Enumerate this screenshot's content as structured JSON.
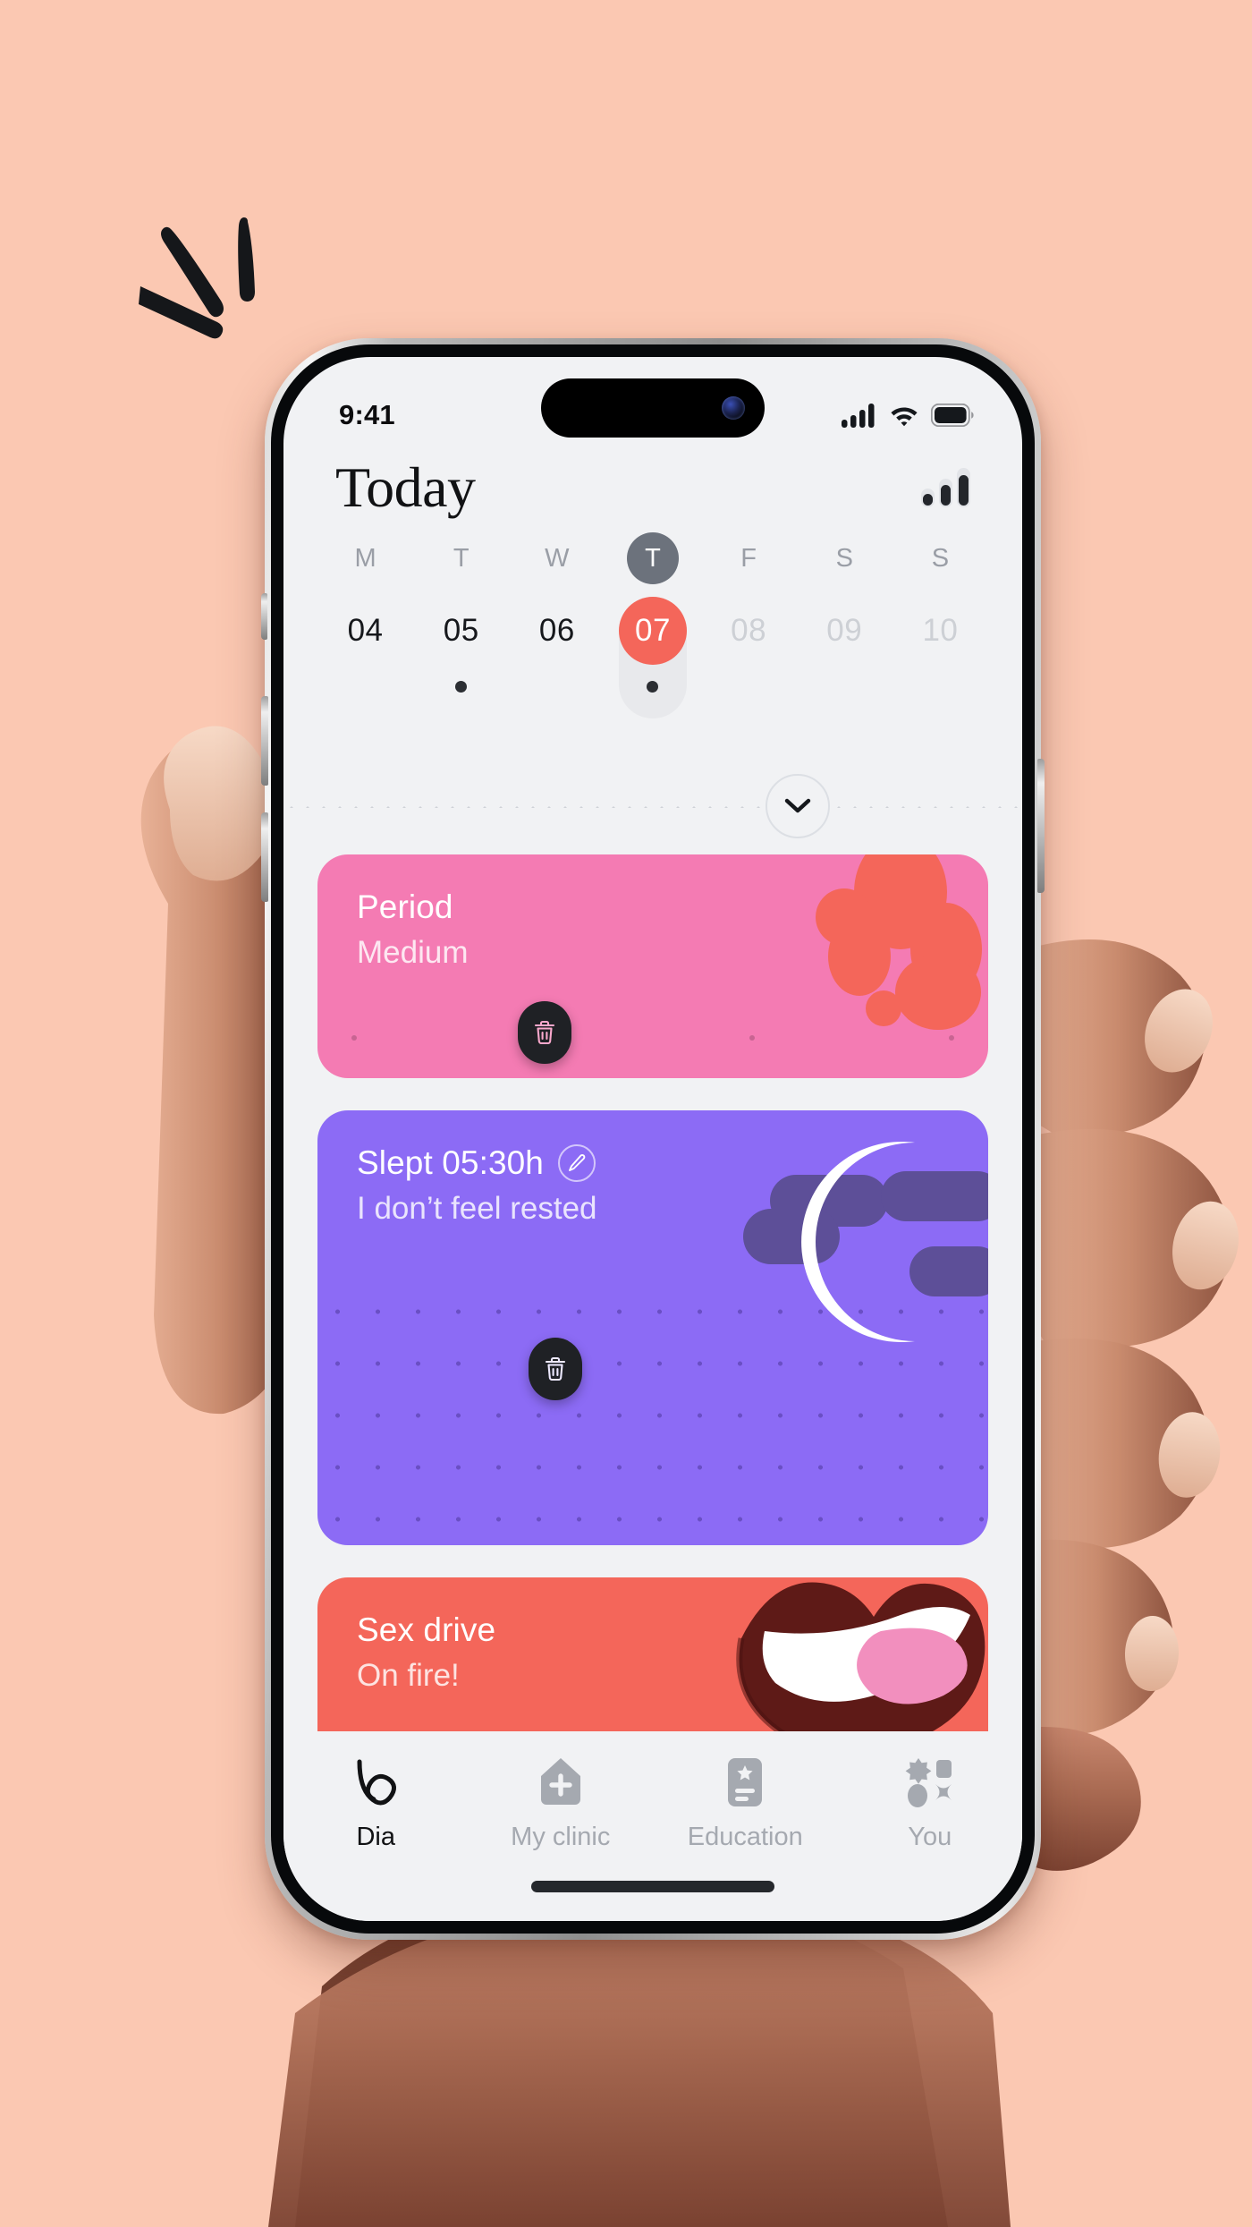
{
  "background_color": "#FBC8B2",
  "status_bar": {
    "time": "9:41",
    "icons": [
      "cellular-signal-icon",
      "wifi-icon",
      "battery-icon"
    ]
  },
  "header": {
    "title": "Today",
    "right_icon": "insights-bars-icon"
  },
  "calendar": {
    "expand_icon": "chevron-down-icon",
    "days": [
      {
        "dow": "M",
        "date": "04",
        "today": false,
        "selected": false,
        "dot": false,
        "past": true
      },
      {
        "dow": "T",
        "date": "05",
        "today": false,
        "selected": false,
        "dot": true,
        "past": true
      },
      {
        "dow": "W",
        "date": "06",
        "today": false,
        "selected": false,
        "dot": false,
        "past": true
      },
      {
        "dow": "T",
        "date": "07",
        "today": true,
        "selected": true,
        "dot": true,
        "past": false
      },
      {
        "dow": "F",
        "date": "08",
        "today": false,
        "selected": false,
        "dot": false,
        "past": false
      },
      {
        "dow": "S",
        "date": "09",
        "today": false,
        "selected": false,
        "dot": false,
        "past": false
      },
      {
        "dow": "S",
        "date": "10",
        "today": false,
        "selected": false,
        "dot": false,
        "past": false
      }
    ],
    "selected_color": "#F4665A",
    "today_dow_color": "#6C727C"
  },
  "cards": [
    {
      "id": "period",
      "title": "Period",
      "subtitle": "Medium",
      "color": "#F47BB3",
      "art": "blood-drops-illustration",
      "delete_icon": "trash-icon"
    },
    {
      "id": "sleep",
      "title": "Slept 05:30h",
      "subtitle": "I don’t feel rested",
      "color": "#8C6BF5",
      "art": "moon-and-clouds-illustration",
      "edit_icon": "pencil-icon",
      "delete_icon": "trash-icon"
    },
    {
      "id": "sex-drive",
      "title": "Sex drive",
      "subtitle": "On fire!",
      "color": "#F4665A",
      "art": "lips-tongue-illustration",
      "delete_icon": "trash-icon"
    }
  ],
  "peek_card_color": "#5FA8DC",
  "tabs": [
    {
      "label": "Dia",
      "icon": "dia-logo-icon",
      "active": true
    },
    {
      "label": "My clinic",
      "icon": "clinic-house-icon",
      "active": false
    },
    {
      "label": "Education",
      "icon": "book-icon",
      "active": false
    },
    {
      "label": "You",
      "icon": "shapes-profile-icon",
      "active": false
    }
  ]
}
